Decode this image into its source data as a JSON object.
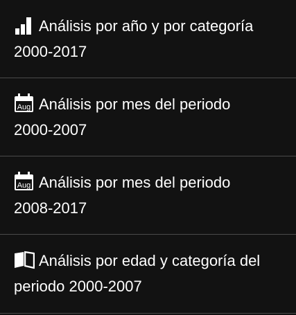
{
  "menu": {
    "items": [
      {
        "icon": "bar-chart-icon",
        "line1": "Análisis por año y por categoría",
        "line2": "2000-2017"
      },
      {
        "icon": "calendar-icon",
        "icon_text": "Aug",
        "line1": "Análisis por mes del periodo",
        "line2": "2000-2007"
      },
      {
        "icon": "calendar-icon",
        "icon_text": "Aug",
        "line1": "Análisis por mes del periodo",
        "line2": "2008-2017"
      },
      {
        "icon": "book-icon",
        "line1": "Análisis por edad y categoría del",
        "line2": "periodo 2000-2007"
      }
    ]
  },
  "colors": {
    "background": "#121212",
    "text": "#ffffff",
    "divider": "#4a4a4a"
  }
}
